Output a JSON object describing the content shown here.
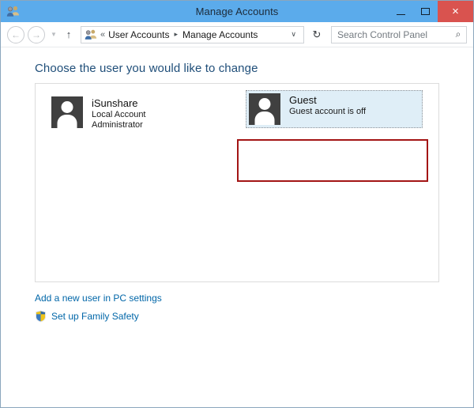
{
  "window": {
    "title": "Manage Accounts",
    "title_icon": "user-accounts-icon",
    "controls": {
      "minimize": "–",
      "maximize": "□",
      "close": "×"
    }
  },
  "navbar": {
    "back": "←",
    "forward": "→",
    "history_chevron": "▼",
    "up": "↑",
    "address": {
      "icon": "user-accounts-icon",
      "overflow": "«",
      "crumb1": "User Accounts",
      "separator": "▸",
      "crumb2": "Manage Accounts",
      "dropdown": "∨"
    },
    "refresh": "↻",
    "search": {
      "placeholder": "Search Control Panel",
      "icon": "⌕"
    }
  },
  "content": {
    "heading": "Choose the user you would like to change",
    "accounts": [
      {
        "name": "iSunshare",
        "type": "Local Account",
        "role": "Administrator",
        "selected": false
      },
      {
        "name": "Guest",
        "status": "Guest account is off",
        "selected": true
      }
    ],
    "links": {
      "add_user": "Add a new user in PC settings",
      "family_safety": "Set up Family Safety"
    }
  },
  "colors": {
    "titlebar": "#5babeb",
    "close_button": "#d9534f",
    "heading": "#1f4e79",
    "link": "#0066a8",
    "selection": "#dfeef7",
    "annotation": "#a31515",
    "avatar": "#404040"
  }
}
